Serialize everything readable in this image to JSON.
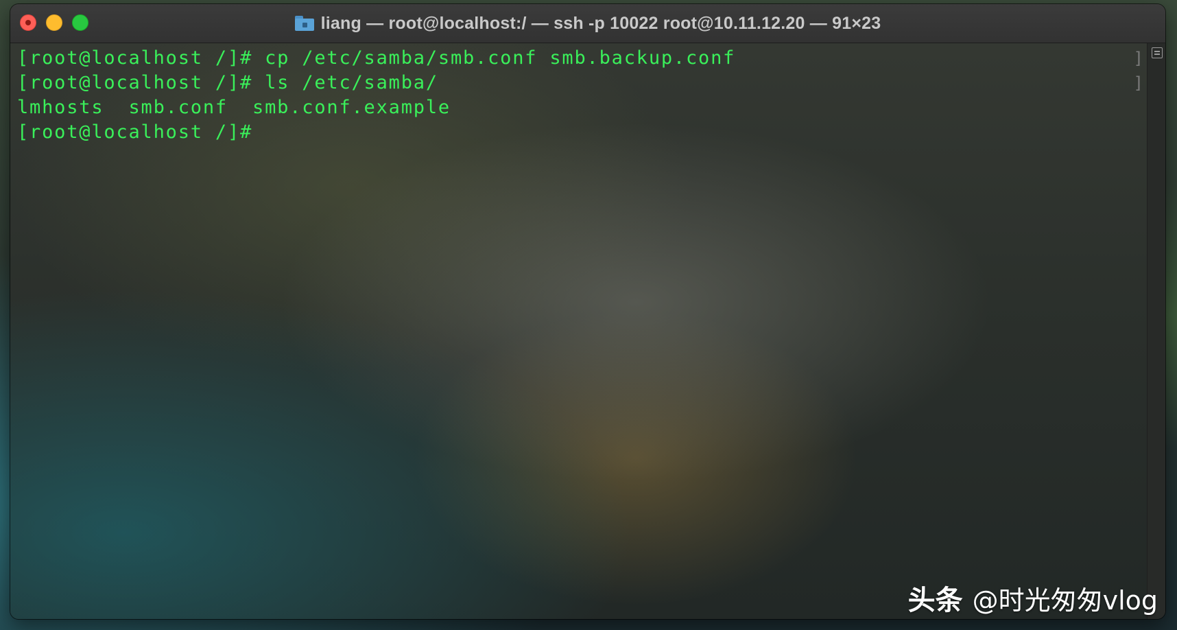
{
  "window": {
    "title": "liang — root@localhost:/ — ssh -p 10022 root@10.11.12.20 — 91×23"
  },
  "terminal": {
    "lines": [
      {
        "mark": "[",
        "text": "[root@localhost /]# cp /etc/samba/smb.conf smb.backup.conf"
      },
      {
        "mark": "[",
        "text": "[root@localhost /]# ls /etc/samba/"
      },
      {
        "mark": "",
        "text": "lmhosts  smb.conf  smb.conf.example"
      },
      {
        "mark": "",
        "text": "[root@localhost /]# "
      }
    ],
    "text_color": "#3af05a"
  },
  "watermark": {
    "brand": "头条",
    "handle": "@时光匆匆vlog"
  },
  "colors": {
    "close": "#fe5f57",
    "minimize": "#febc2e",
    "maximize": "#28c840"
  },
  "icons": {
    "folder": "folder-icon",
    "marks": "marks-list-icon"
  }
}
